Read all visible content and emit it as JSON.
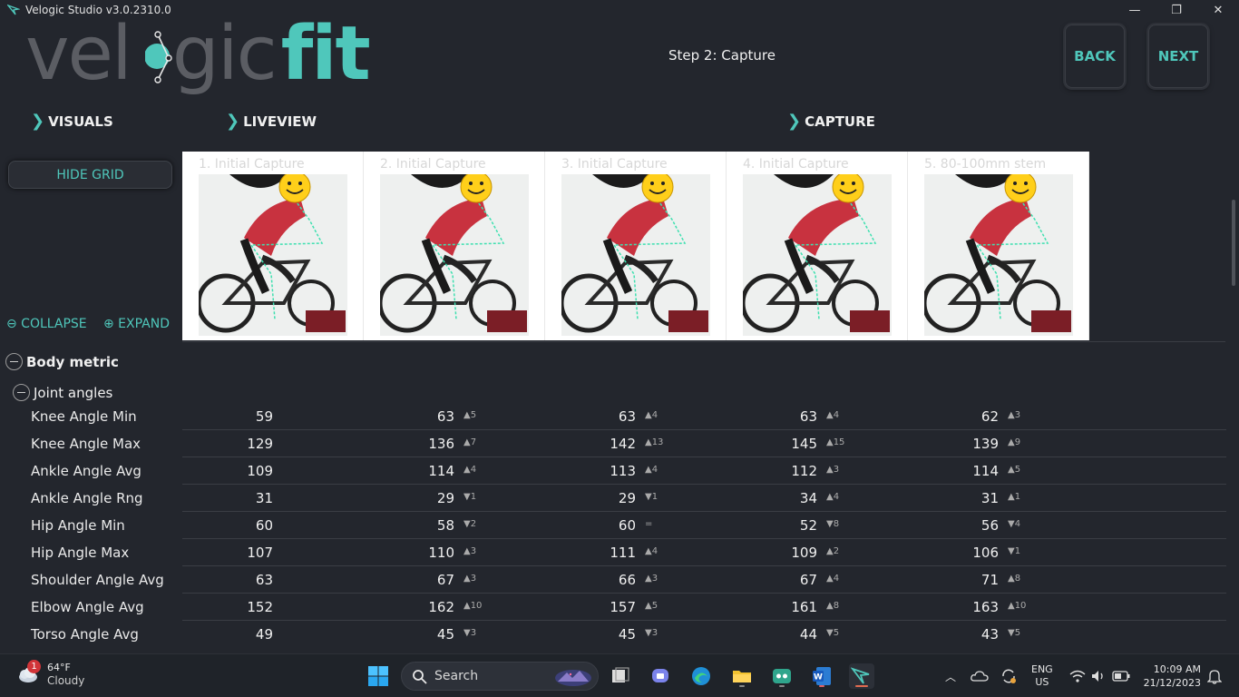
{
  "window": {
    "title": "Velogic Studio v3.0.2310.0",
    "minimize": "—",
    "maximize": "❐",
    "close": "✕"
  },
  "logo": {
    "part1": "vel",
    "part2": "gic",
    "part3": "fit"
  },
  "header": {
    "step": "Step 2: Capture",
    "back": "BACK",
    "next": "NEXT"
  },
  "sections": {
    "visuals": "VISUALS",
    "liveview": "LIVEVIEW",
    "capture": "CAPTURE"
  },
  "left_panel": {
    "hide_grid": "HIDE GRID",
    "collapse": "⊖ COLLAPSE",
    "expand": "⊕ EXPAND"
  },
  "captures": [
    {
      "label": "1. Initial Capture"
    },
    {
      "label": "2. Initial Capture"
    },
    {
      "label": "3. Initial Capture"
    },
    {
      "label": "4. Initial Capture"
    },
    {
      "label": "5. 80-100mm stem"
    }
  ],
  "tree": {
    "root": "Body metric",
    "group": "Joint angles"
  },
  "rows": [
    {
      "name": "Knee Angle Min",
      "cells": [
        [
          "59",
          ""
        ],
        [
          "63",
          "▲5"
        ],
        [
          "63",
          "▲4"
        ],
        [
          "63",
          "▲4"
        ],
        [
          "62",
          "▲3"
        ]
      ]
    },
    {
      "name": "Knee Angle Max",
      "cells": [
        [
          "129",
          ""
        ],
        [
          "136",
          "▲7"
        ],
        [
          "142",
          "▲13"
        ],
        [
          "145",
          "▲15"
        ],
        [
          "139",
          "▲9"
        ]
      ]
    },
    {
      "name": "Ankle Angle Avg",
      "cells": [
        [
          "109",
          ""
        ],
        [
          "114",
          "▲4"
        ],
        [
          "113",
          "▲4"
        ],
        [
          "112",
          "▲3"
        ],
        [
          "114",
          "▲5"
        ]
      ]
    },
    {
      "name": "Ankle Angle Rng",
      "cells": [
        [
          "31",
          ""
        ],
        [
          "29",
          "▼1"
        ],
        [
          "29",
          "▼1"
        ],
        [
          "34",
          "▲4"
        ],
        [
          "31",
          "▲1"
        ]
      ]
    },
    {
      "name": "Hip Angle Min",
      "cells": [
        [
          "60",
          ""
        ],
        [
          "58",
          "▼2"
        ],
        [
          "60",
          "="
        ],
        [
          "52",
          "▼8"
        ],
        [
          "56",
          "▼4"
        ]
      ]
    },
    {
      "name": "Hip Angle Max",
      "cells": [
        [
          "107",
          ""
        ],
        [
          "110",
          "▲3"
        ],
        [
          "111",
          "▲4"
        ],
        [
          "109",
          "▲2"
        ],
        [
          "106",
          "▼1"
        ]
      ]
    },
    {
      "name": "Shoulder Angle Avg",
      "cells": [
        [
          "63",
          ""
        ],
        [
          "67",
          "▲3"
        ],
        [
          "66",
          "▲3"
        ],
        [
          "67",
          "▲4"
        ],
        [
          "71",
          "▲8"
        ]
      ]
    },
    {
      "name": "Elbow Angle Avg",
      "cells": [
        [
          "152",
          ""
        ],
        [
          "162",
          "▲10"
        ],
        [
          "157",
          "▲5"
        ],
        [
          "161",
          "▲8"
        ],
        [
          "163",
          "▲10"
        ]
      ]
    },
    {
      "name": "Torso Angle Avg",
      "cells": [
        [
          "49",
          ""
        ],
        [
          "45",
          "▼3"
        ],
        [
          "45",
          "▼3"
        ],
        [
          "44",
          "▼5"
        ],
        [
          "43",
          "▼5"
        ]
      ]
    }
  ],
  "taskbar": {
    "weather_temp": "64°F",
    "weather_cond": "Cloudy",
    "weather_badge": "1",
    "search": "Search",
    "lang1": "ENG",
    "lang2": "US",
    "time": "10:09 AM",
    "date": "21/12/2023"
  },
  "colors": {
    "accent": "#4fc7bb",
    "background": "#23262d"
  }
}
